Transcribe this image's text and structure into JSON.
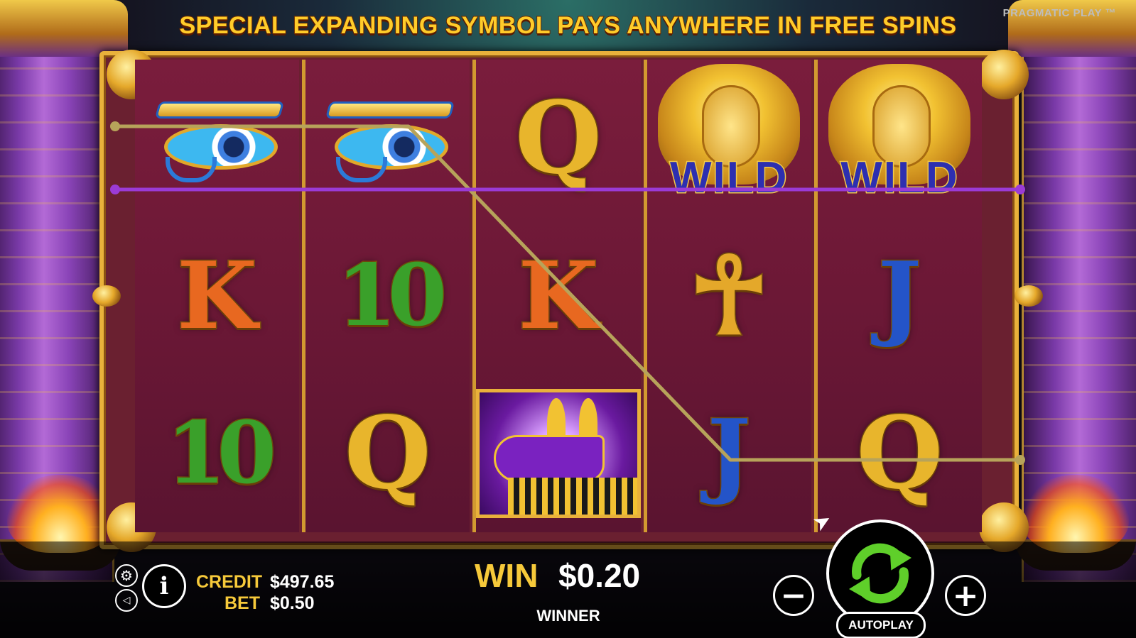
{
  "banner": {
    "text": "SPECIAL EXPANDING SYMBOL PAYS ANYWHERE IN FREE SPINS"
  },
  "brand": {
    "text": "PRAGMATIC PLAY ™"
  },
  "colors": {
    "banner": "#ffcc2a",
    "label_gold": "#f6c93a",
    "reel_bg": "#7a1d3c",
    "frame_gold": "#e9b13b",
    "payline_gold": "#b7a35a",
    "payline_purple": "#9b3bd6",
    "spin_green": "#5fcf2a"
  },
  "reels": [
    {
      "symbols": [
        "eye",
        "K",
        "10"
      ]
    },
    {
      "symbols": [
        "eye",
        "10",
        "Q"
      ]
    },
    {
      "symbols": [
        "Q",
        "K",
        "anubis"
      ]
    },
    {
      "symbols": [
        "wild",
        "ankh",
        "J"
      ]
    },
    {
      "symbols": [
        "wild",
        "J",
        "Q"
      ]
    }
  ],
  "symbols": {
    "K": "K",
    "Q": "Q",
    "J": "J",
    "ten": "10",
    "ankh": "☥",
    "wild": "WILD"
  },
  "bottom": {
    "credit_label": "CREDIT",
    "credit_value": "$497.65",
    "bet_label": "BET",
    "bet_value": "$0.50",
    "win_label": "WIN",
    "win_value": "$0.20",
    "status": "WINNER",
    "autoplay": "AUTOPLAY",
    "info_glyph": "i",
    "minus_glyph": "−",
    "plus_glyph": "+"
  },
  "icons": [
    "settings-icon",
    "sound-icon",
    "info-icon",
    "minus-icon",
    "plus-icon",
    "spin-icon"
  ]
}
